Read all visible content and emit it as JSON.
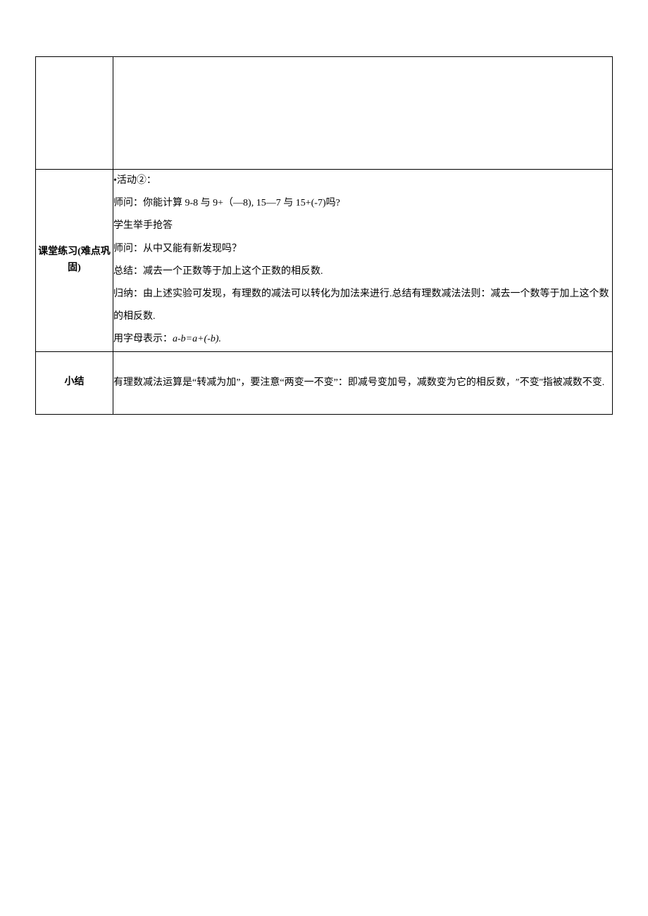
{
  "rows": {
    "row1": {
      "label": "",
      "content": ""
    },
    "row2": {
      "label": "课堂练习(难点巩固)",
      "lines": {
        "l1": "•活动②：",
        "l2": "师问：你能计算 9-8 与 9+（—8), 15—7 与 15+(-7)吗?",
        "l3": "学生举手抢答",
        "l4": "师问：从中又能有新发现吗？",
        "l5": "总结：减去一个正数等于加上这个正数的相反数.",
        "l6": "归纳：由上述实验可发现，有理数的减法可以转化为加法来进行.总结有理数减法法则：减去一个数等于加上这个数的相反数.",
        "l7_prefix": "用字母表示：",
        "l7_formula": "a-b=a+(-b).",
        "l7_full": "用字母表示：a-b=a+(-b)."
      }
    },
    "row3": {
      "label": "小结",
      "content": "有理数减法运算是“转减为加”，要注意“两变一不变”：即减号变加号，减数变为它的相反数，″不变''指被减数不变."
    }
  }
}
